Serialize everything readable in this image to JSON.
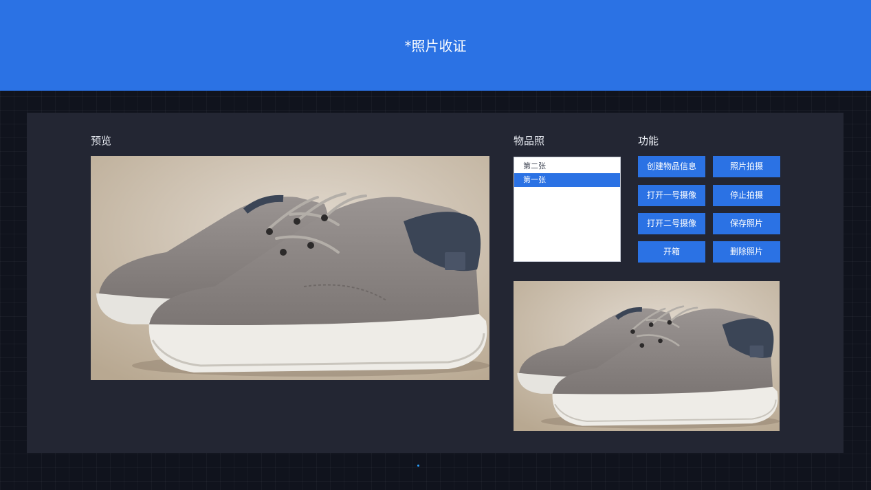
{
  "header": {
    "title": "*照片收证"
  },
  "preview": {
    "label": "预览",
    "image_icon": "shoe-photo"
  },
  "photos": {
    "label": "物品照",
    "items": [
      "第二张",
      "第一张"
    ],
    "selected_index": 1,
    "thumbnail_icon": "shoe-photo"
  },
  "functions": {
    "label": "功能",
    "create_item_info": "创建物品信息",
    "take_photo": "照片拍摄",
    "open_camera_1": "打开一号摄像",
    "stop_capture": "停止拍摄",
    "open_camera_2": "打开二号摄像",
    "save_photo": "保存照片",
    "open_box": "开箱",
    "delete_photo": "删除照片"
  },
  "colors": {
    "accent": "#2b72e4",
    "page_background": "#10131d",
    "panel_background": "#232633",
    "shoe_upper": "#8c8684",
    "shoe_collar": "#3b4556",
    "photo_background": "#c7b9a5"
  }
}
